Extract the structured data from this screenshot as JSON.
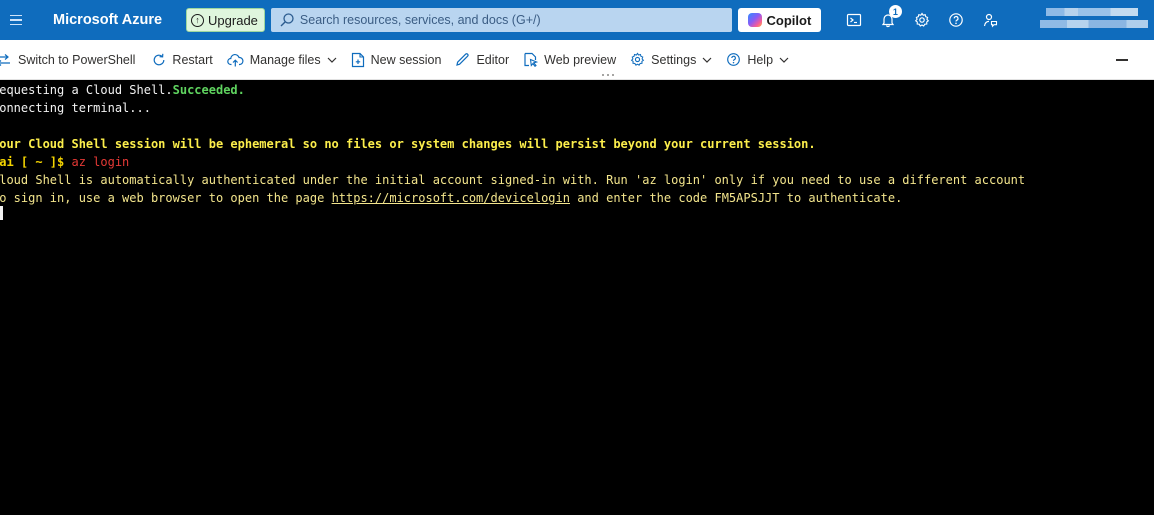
{
  "header": {
    "brand": "Microsoft Azure",
    "upgrade_label": "Upgrade",
    "search_placeholder": "Search resources, services, and docs (G+/)",
    "copilot_label": "Copilot",
    "notification_count": "1",
    "colors": {
      "header_bg": "#0f6cbd",
      "upgrade_bg": "#dff6dd",
      "search_bg": "#b9d5f0"
    }
  },
  "toolbar": {
    "switch_label": "Switch to PowerShell",
    "restart_label": "Restart",
    "manage_files_label": "Manage files",
    "new_session_label": "New session",
    "editor_label": "Editor",
    "web_preview_label": "Web preview",
    "settings_label": "Settings",
    "help_label": "Help"
  },
  "terminal": {
    "line1_prefix": "Requesting a Cloud Shell.",
    "line1_status": "Succeeded.",
    "line2": "Connecting terminal...",
    "warning": "Your Cloud Shell session will be ephemeral so no files or system changes will persist beyond your current session.",
    "prompt": "kai [ ~ ]$ ",
    "command": "az login",
    "info_line": "Cloud Shell is automatically authenticated under the initial account signed-in with. Run 'az login' only if you need to use a different account",
    "signin_prefix": "To sign in, use a web browser to open the page ",
    "signin_url": "https://microsoft.com/devicelogin",
    "signin_suffix": " and enter the code FM5APSJJT to authenticate."
  }
}
